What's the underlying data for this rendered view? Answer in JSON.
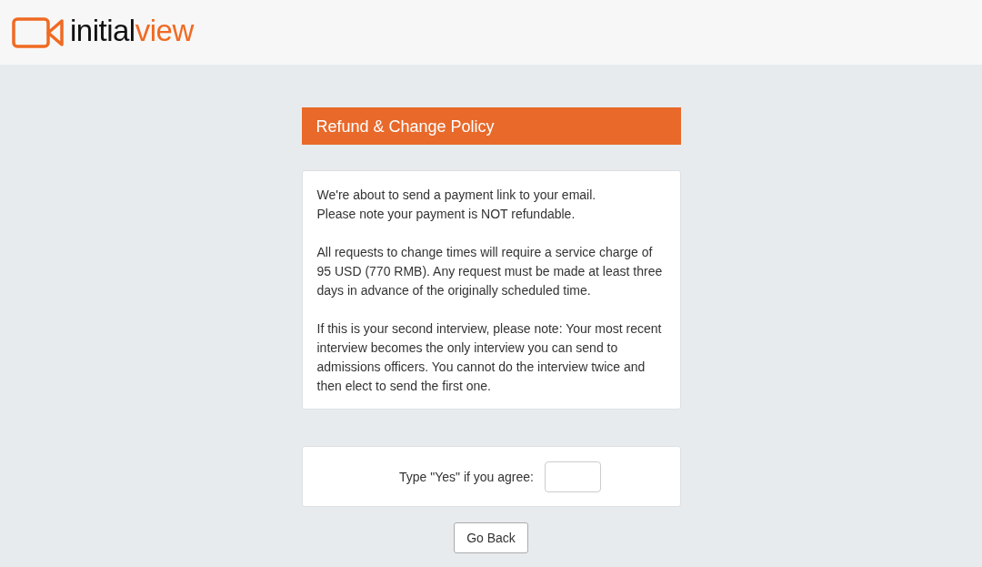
{
  "header": {
    "logo": {
      "dark": "initial",
      "accent": "view"
    }
  },
  "policy": {
    "title": "Refund & Change Policy",
    "paragraphs": [
      "We're about to send a payment link to your email.\nPlease note your payment is NOT refundable.",
      "All requests to change times will require a service charge of 95 USD (770 RMB). Any request must be made at least three days in advance of the originally scheduled time.",
      "If this is your second interview, please note: Your most recent interview becomes the only interview you can send to admissions officers. You cannot do the interview twice and then elect to send the first one."
    ]
  },
  "agreement": {
    "label": "Type \"Yes\" if you agree:"
  },
  "buttons": [
    "Go Back"
  ]
}
